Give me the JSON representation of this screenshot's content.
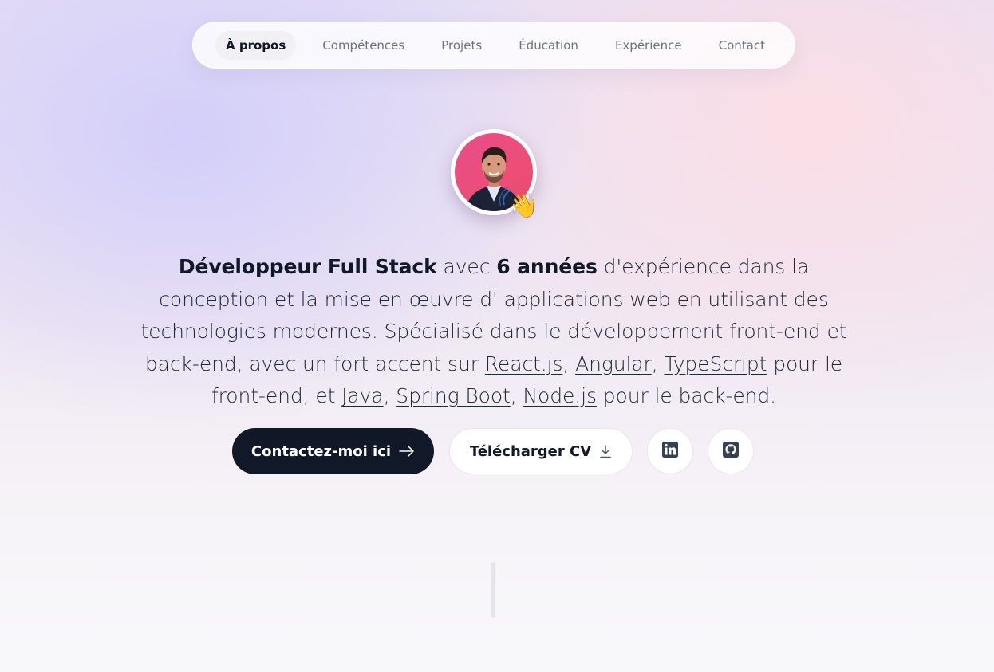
{
  "nav": {
    "items": [
      {
        "label": "À propos",
        "active": true
      },
      {
        "label": "Compétences",
        "active": false
      },
      {
        "label": "Projets",
        "active": false
      },
      {
        "label": "Éducation",
        "active": false
      },
      {
        "label": "Expérience",
        "active": false
      },
      {
        "label": "Contact",
        "active": false
      }
    ]
  },
  "hero": {
    "avatar_icon": "profile-photo",
    "wave_emoji": "👋",
    "bio": {
      "role": "Développeur Full Stack",
      "text_1": " avec ",
      "years": "6 années",
      "text_2": " d'expérience dans la conception et la mise en œuvre d' applications web en utilisant des technologies modernes. Spécialisé dans le développement front-end et back-end, avec un fort accent sur ",
      "tech_1": "React.js",
      "sep_1": ", ",
      "tech_2": "Angular",
      "sep_2": ", ",
      "tech_3": "TypeScript",
      "text_3": " pour le front-end, et ",
      "tech_4": "Java",
      "sep_3": ", ",
      "tech_5": "Spring Boot",
      "sep_4": ", ",
      "tech_6": "Node.js",
      "text_4": " pour le back-end."
    },
    "buttons": {
      "contact_label": "Contactez-moi ici",
      "cv_label": "Télécharger CV",
      "linkedin_icon": "linkedin-icon",
      "github_icon": "github-icon"
    }
  },
  "colors": {
    "primary_button": "#111827",
    "accent_avatar": "#e94c8b"
  }
}
